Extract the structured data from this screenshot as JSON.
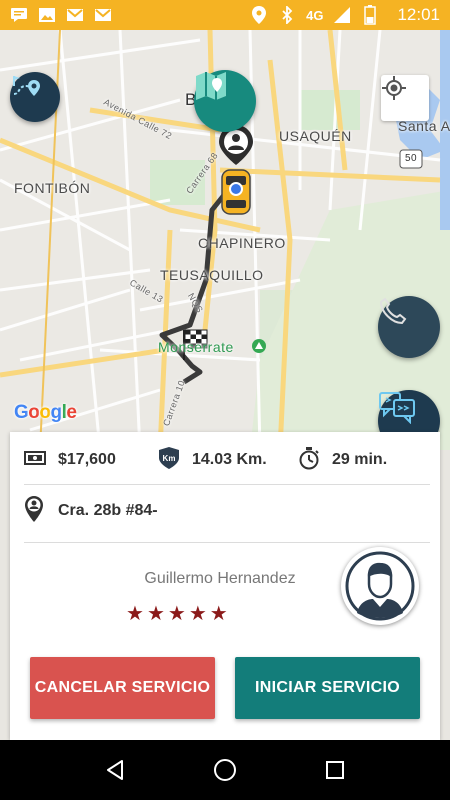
{
  "status_bar": {
    "network": "4G",
    "time": "12:01",
    "icons": [
      "message-icon",
      "image-icon",
      "gmail-icon",
      "gmail-icon",
      "location-icon",
      "bluetooth-icon",
      "signal-icon",
      "battery-icon"
    ]
  },
  "map": {
    "labels": {
      "bogota": "Bogotá",
      "usaquen": "USAQUÉN",
      "santa_ana": "Santa A",
      "fontibon": "FONTIBÓN",
      "chapinero": "CHAPINERO",
      "teusaquillo": "TEUSAQUILLO",
      "monserrate": "Monserrate",
      "avenida": "Avenida Calle 72",
      "carrera68": "Carrera 68",
      "calle13": "Calle 13",
      "nqs": "NQS",
      "carrera10": "Carrera 10",
      "route50": "50"
    },
    "google": "Google",
    "colors": {
      "route": "#3a3a3a",
      "water": "#a9c9f0",
      "park": "#c6e6bd",
      "roads_major": "#f9d77e"
    }
  },
  "trip": {
    "price": "$17,600",
    "distance": "14.03 Km.",
    "duration": "29 min.",
    "address": "Cra. 28b #84-"
  },
  "driver": {
    "name": "Guillermo Hernandez",
    "rating": 5,
    "stars": [
      "★",
      "★",
      "★",
      "★",
      "★"
    ]
  },
  "actions": {
    "cancel_label": "CANCELAR SERVICIO",
    "start_label": "INICIAR SERVICIO"
  },
  "colors": {
    "status_bar": "#f5b323",
    "cancel": "#d9534f",
    "start": "#137d7a",
    "fab_dark": "#1e3a4f",
    "fab_teal": "#178a7e",
    "star": "#8b1a1a"
  }
}
